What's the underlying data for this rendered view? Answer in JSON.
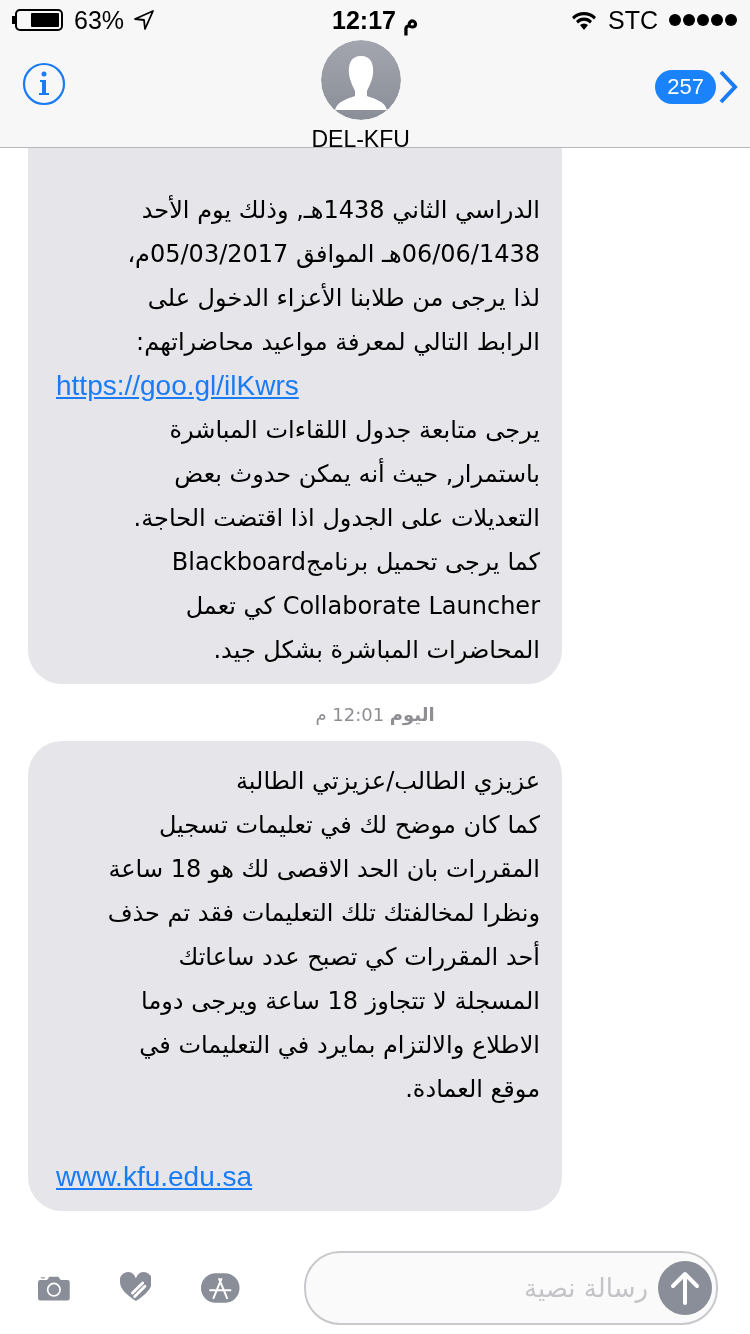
{
  "status_bar": {
    "battery": "63%",
    "time": "12:17 م",
    "carrier": "STC"
  },
  "header": {
    "contact": "DEL-KFU",
    "unread_count": "257"
  },
  "conversation": [
    {
      "kind": "bubble",
      "clipped": true,
      "lines": [
        {
          "kind": "text",
          "text": "الدراسي الثاني  1438هـ, وذلك يوم الأحد"
        },
        {
          "kind": "text",
          "text": "06/06/1438هـ الموافق 05/03/2017م،"
        },
        {
          "kind": "text",
          "text": "لذا يرجى من طلابنا الأعزاء الدخول على"
        },
        {
          "kind": "text",
          "text": "الرابط التالي لمعرفة مواعيد محاضراتهم:"
        },
        {
          "kind": "link",
          "text": "https://goo.gl/ilKwrs"
        },
        {
          "kind": "text",
          "text": "يرجى متابعة جدول اللقاءات المباشرة"
        },
        {
          "kind": "text",
          "text": "باستمرار, حيث أنه يمكن حدوث بعض"
        },
        {
          "kind": "text",
          "text": "التعديلات على الجدول اذا اقتضت الحاجة."
        },
        {
          "kind": "text",
          "text": "كما يرجى تحميل برنامجBlackboard"
        },
        {
          "kind": "text",
          "text": "Collaborate Launcher كي تعمل"
        },
        {
          "kind": "text",
          "text": "المحاضرات المباشرة بشكل جيد."
        }
      ]
    },
    {
      "kind": "timestamp",
      "text": "**اليوم** 12:01 م"
    },
    {
      "kind": "bubble",
      "clipped": false,
      "lines": [
        {
          "kind": "text",
          "text": "عزيزي الطالب/عزيزتي الطالبة"
        },
        {
          "kind": "text",
          "text": "كما كان موضح لك في تعليمات تسجيل"
        },
        {
          "kind": "text",
          "text": "المقررات  بان الحد الاقصى لك هو 18 ساعة"
        },
        {
          "kind": "text",
          "text": "ونظرا لمخالفتك تلك التعليمات فقد تم حذف"
        },
        {
          "kind": "text",
          "text": "أحد المقررات كي تصبح عدد ساعاتك"
        },
        {
          "kind": "text",
          "text": "المسجلة لا تتجاوز 18 ساعة ويرجى دوما"
        },
        {
          "kind": "text",
          "text": "الاطلاع والالتزام بمايرد في التعليمات في"
        },
        {
          "kind": "text",
          "text": "موقع العمادة."
        },
        {
          "kind": "blank"
        },
        {
          "kind": "link",
          "text": "www.kfu.edu.sa"
        }
      ]
    }
  ],
  "composer": {
    "placeholder": "رسالة نصية"
  }
}
